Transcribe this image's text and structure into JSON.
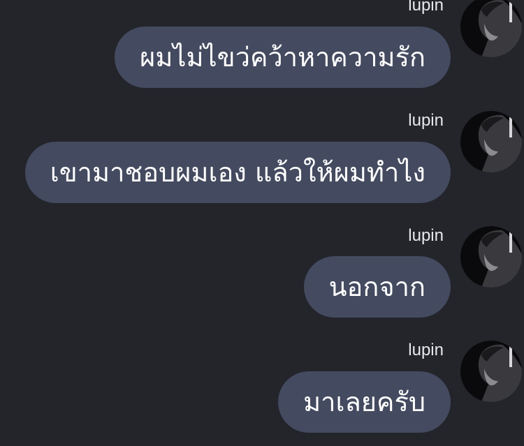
{
  "messages": [
    {
      "sender": "lupin",
      "text": "ผมไม่ไขว่คว้าหาความรัก",
      "avatar_icon": "profile-photo-icon"
    },
    {
      "sender": "lupin",
      "text": "เขามาชอบผมเอง แล้วให้ผมทำไง",
      "avatar_icon": "profile-photo-icon"
    },
    {
      "sender": "lupin",
      "text": "นอกจาก",
      "avatar_icon": "profile-photo-icon"
    },
    {
      "sender": "lupin",
      "text": "มาเลยครับ",
      "avatar_icon": "profile-photo-icon"
    }
  ],
  "colors": {
    "background": "#23252b",
    "bubble": "#444a5f",
    "text": "#ffffff",
    "sender": "#e8e8ec"
  }
}
